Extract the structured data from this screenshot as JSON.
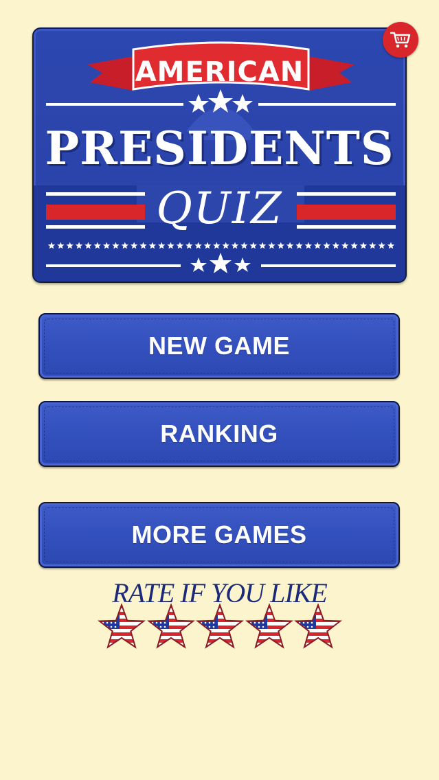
{
  "logo": {
    "line1": "AMERICAN",
    "line2": "PRESIDENTS",
    "line3": "QUIZ"
  },
  "cart": {
    "icon": "shopping-cart-icon",
    "color": "#d9262b"
  },
  "menu": {
    "new_game": "NEW GAME",
    "ranking": "RANKING",
    "more_games": "MORE GAMES"
  },
  "rate": {
    "label": "RATE IF YOU LIKE",
    "star_count": 5,
    "star_icon": "american-flag-star-icon"
  },
  "colors": {
    "background": "#fbf4cc",
    "button_blue": "#3350bd",
    "accent_red": "#d9262b",
    "rate_text": "#1b2a7a"
  }
}
